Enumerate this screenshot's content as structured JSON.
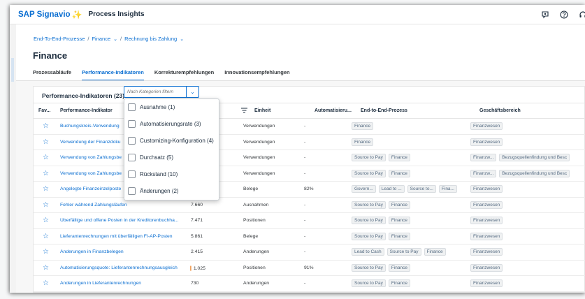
{
  "shell": {
    "logo": "SAP Signavio",
    "product": "Process Insights"
  },
  "breadcrumb": {
    "items": [
      "End-To-End-Prozesse",
      "Finance",
      "Rechnung bis Zahlung"
    ],
    "separator": "/"
  },
  "page": {
    "title": "Finance"
  },
  "tabs": [
    {
      "label": "Prozessabläufe"
    },
    {
      "label": "Performance-Indikatoren",
      "active": true
    },
    {
      "label": "Korrekturempfehlungen"
    },
    {
      "label": "Innovationsempfehlungen"
    }
  ],
  "card": {
    "title": "Performance-Indikatoren (23)",
    "filter_placeholder": "Nach Kategorien filtern"
  },
  "table": {
    "headers": [
      "Fav...",
      "Performance-Indikator",
      "",
      "Einheit",
      "Automatisieru...",
      "End-to-End-Prozess",
      "Geschäftsbereich"
    ],
    "rows": [
      {
        "name": "Buchungskreis-Verwendung",
        "value": "",
        "unit": "Verwendungen",
        "auto": "-",
        "processes": [
          "Finance"
        ],
        "business": [
          "Finanzwesen"
        ]
      },
      {
        "name": "Verwendung der Finanzdoku",
        "value": "",
        "unit": "Verwendungen",
        "auto": "-",
        "processes": [
          "Finance"
        ],
        "business": [
          "Finanzwesen"
        ]
      },
      {
        "name": "Verwendung von Zahlungsbe",
        "value": "",
        "unit": "Verwendungen",
        "auto": "-",
        "processes": [
          "Source to Pay",
          "Finance"
        ],
        "business": [
          "Finanzw...",
          "Bezugsquellenfindung und Besc"
        ]
      },
      {
        "name": "Verwendung von Zahlungsbe",
        "value": "",
        "unit": "Verwendungen",
        "auto": "-",
        "processes": [
          "Source to Pay",
          "Finance"
        ],
        "business": [
          "Finanzw...",
          "Bezugsquellenfindung und Besc"
        ]
      },
      {
        "name": "Angelegte Finanzeinzelposte",
        "value": "",
        "unit": "Belege",
        "auto": "82%",
        "processes": [
          "Govern...",
          "Lead to ...",
          "Source to...",
          "Fina..."
        ],
        "business": [
          "Finanzwesen"
        ]
      },
      {
        "name": "Fehler während Zahlungsläufen",
        "value": "7.660",
        "unit": "Ausnahmen",
        "auto": "-",
        "processes": [
          "Source to Pay",
          "Finance"
        ],
        "business": [
          "Finanzwesen"
        ]
      },
      {
        "name": "Überfällige und offene Posten in der Kreditorenbuchha...",
        "value": "7.471",
        "unit": "Positionen",
        "auto": "-",
        "processes": [
          "Source to Pay",
          "Finance"
        ],
        "business": [
          "Finanzwesen"
        ]
      },
      {
        "name": "Lieferantenrechnungen mit überfälligen FI-AP-Posten",
        "value": "5.861",
        "unit": "Belege",
        "auto": "-",
        "processes": [
          "Source to Pay",
          "Finance"
        ],
        "business": [
          "Finanzwesen"
        ]
      },
      {
        "name": "Änderungen in Finanzbelegen",
        "value": "2.415",
        "unit": "Änderungen",
        "auto": "-",
        "processes": [
          "Lead to Cash",
          "Source to Pay",
          "Finance"
        ],
        "business": [
          "Finanzwesen"
        ]
      },
      {
        "name": "Automatisierungsquote: Lieferantenrechnungsausgleich",
        "value": "1.025",
        "unit": "Positionen",
        "auto": "91%",
        "processes": [
          "Source to Pay",
          "Finance"
        ],
        "business": [
          "Finanzwesen"
        ],
        "warning": true
      },
      {
        "name": "Änderungen in Lieferantenrechnungen",
        "value": "730",
        "unit": "Änderungen",
        "auto": "-",
        "processes": [
          "Source to Pay",
          "Finance"
        ],
        "business": [
          "Finanzwesen"
        ]
      }
    ]
  },
  "dropdown": {
    "options": [
      "Ausnahme (1)",
      "Automatisierungsrate (3)",
      "Customizing-Konfiguration (4)",
      "Durchsatz (5)",
      "Rückstand (10)",
      "Änderungen (2)"
    ]
  },
  "colors": {
    "accent": "#0a6ed1",
    "brand_bird": "#f0ab00",
    "warning": "#e9730c"
  }
}
